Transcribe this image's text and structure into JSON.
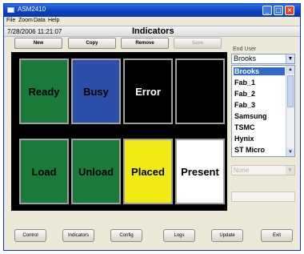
{
  "window": {
    "title": "ASM2410",
    "min_glyph": "_",
    "max_glyph": "□",
    "close_glyph": "×"
  },
  "menu": [
    "File",
    "Zoom",
    "Data",
    "Help"
  ],
  "header": {
    "datetime": "7/28/2006 11:21:07",
    "title": "Indicators"
  },
  "toolbar": {
    "new_label": "New",
    "copy_label": "Copy",
    "remove_label": "Remove",
    "save_label": "Save"
  },
  "indicators": [
    {
      "label": "Ready",
      "bg": "#1a7a3a",
      "fg": "#000000"
    },
    {
      "label": "Busy",
      "bg": "#2b4fa8",
      "fg": "#000000"
    },
    {
      "label": "Error",
      "bg": "#000000",
      "fg": "#ffffff"
    },
    {
      "label": "",
      "bg": "#000000",
      "fg": "#ffffff"
    },
    {
      "label": "Load",
      "bg": "#1a7a3a",
      "fg": "#000000"
    },
    {
      "label": "Unload",
      "bg": "#1a7a3a",
      "fg": "#000000"
    },
    {
      "label": "Placed",
      "bg": "#f2ea14",
      "fg": "#000000"
    },
    {
      "label": "Present",
      "bg": "#ffffff",
      "fg": "#000000"
    }
  ],
  "right_panel": {
    "end_user_label": "End User",
    "end_user_selected": "Brooks",
    "end_user_options": [
      "Brooks",
      "Fab_1",
      "Fab_2",
      "Fab_3",
      "Samsung",
      "TSMC",
      "Hynix",
      "ST Micro"
    ],
    "selected_index": 0,
    "secondary_select_value": "None"
  },
  "bottom_buttons": {
    "control": "Control",
    "indicators": "Indicators",
    "config": "Config",
    "logs": "Logs",
    "update": "Update",
    "exit": "Exit"
  }
}
